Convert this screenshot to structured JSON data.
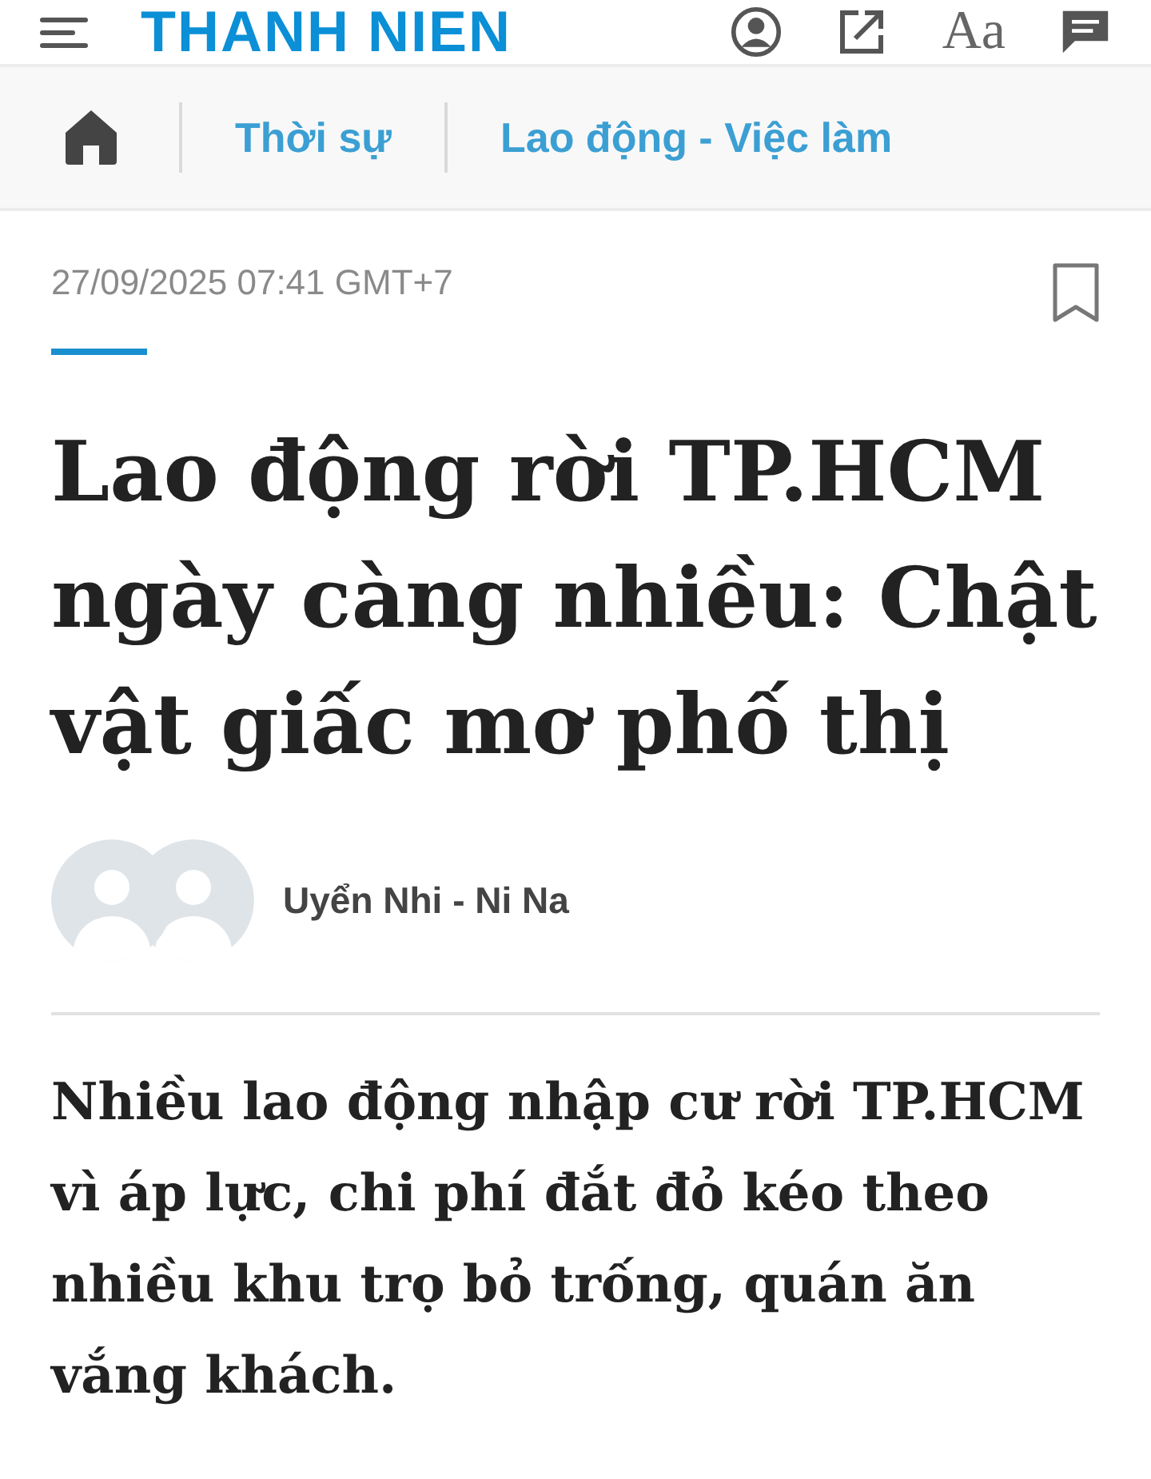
{
  "header": {
    "logo": "THANH NIEN",
    "font_button": "Aa"
  },
  "breadcrumb": {
    "items": [
      "Thời sự",
      "Lao động - Việc làm"
    ]
  },
  "article": {
    "date": "27/09/2025 07:41 GMT+7",
    "title": "Lao động rời TP.HCM ngày càng nhiều: Chật vật giấc mơ phố thị",
    "author": "Uyển Nhi - Ni Na",
    "sapo": "Nhiều lao động nhập cư rời TP.HCM vì áp lực, chi phí đắt đỏ kéo theo nhiều khu trọ bỏ trống, quán ăn vắng khách."
  }
}
